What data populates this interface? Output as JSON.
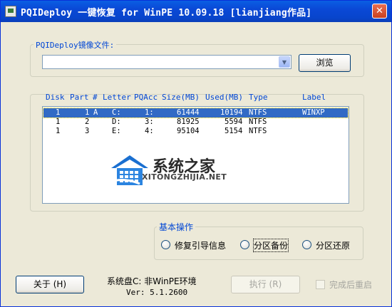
{
  "window": {
    "title": "PQIDeploy 一键恢复 for WinPE 10.09.18 [lianjiang作品]",
    "close_glyph": "✕"
  },
  "image_group": {
    "label": "PQIDeploy镜像文件:",
    "combo_value": "",
    "combo_arrow": "▼",
    "browse_label": "浏览"
  },
  "partition_list": {
    "headers": [
      "Disk",
      "Part",
      "#",
      "Letter",
      "PQAcc",
      "Size(MB)",
      "Used(MB)",
      "Type",
      "Label"
    ],
    "rows": [
      {
        "disk": "1",
        "part": "1",
        "flag": "A",
        "letter": "C:",
        "pqacc": "1:",
        "size": "61444",
        "used": "10194",
        "type": "NTFS",
        "label": "WINXP"
      },
      {
        "disk": "1",
        "part": "2",
        "flag": "",
        "letter": "D:",
        "pqacc": "3:",
        "size": "81925",
        "used": "5594",
        "type": "NTFS",
        "label": ""
      },
      {
        "disk": "1",
        "part": "3",
        "flag": "",
        "letter": "E:",
        "pqacc": "4:",
        "size": "95104",
        "used": "5154",
        "type": "NTFS",
        "label": ""
      }
    ],
    "selected_row": 0,
    "watermark_title": "系统之家",
    "watermark_sub": "XITONGZHIJIA.NET"
  },
  "basic_ops": {
    "label": "基本操作",
    "options": [
      "修复引导信息",
      "分区备份",
      "分区还原"
    ]
  },
  "footer": {
    "about_label": "关于 (H)",
    "system_disk": "系统盘C: 非WinPE环境",
    "version": "Ver: 5.1.2600",
    "execute_label": "执行 (R)",
    "restart_label": "完成后重启"
  },
  "colors": {
    "title_bar": "#0a48d6",
    "group_label": "#0046d5",
    "selection": "#316ac5",
    "face": "#ece9d8"
  }
}
